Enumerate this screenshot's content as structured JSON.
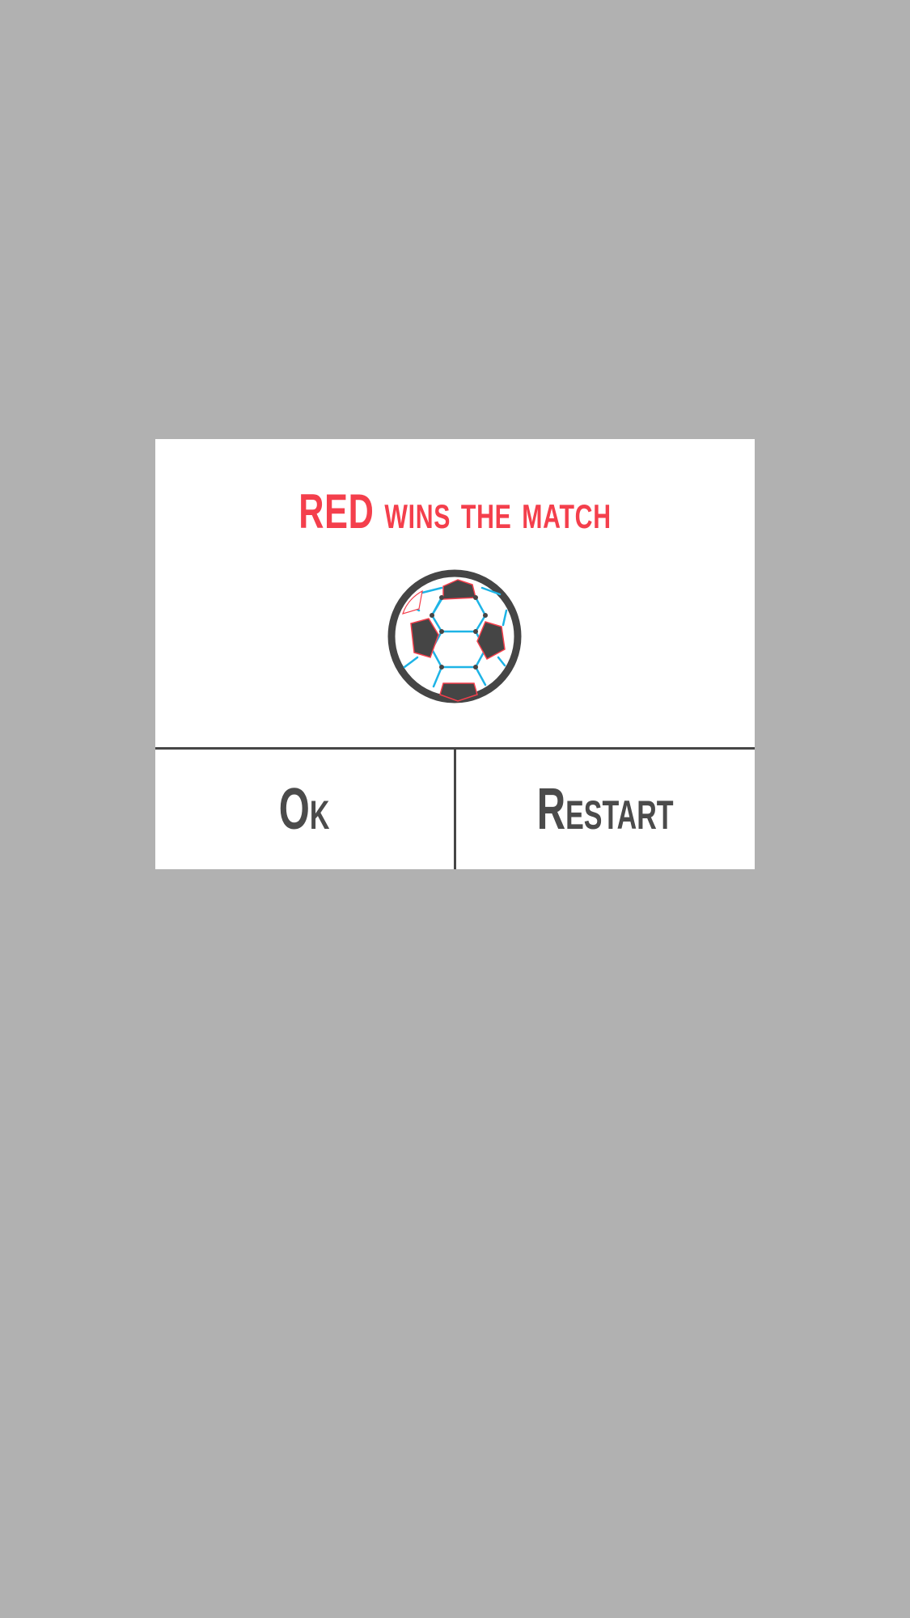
{
  "dialog": {
    "title": "RED wins the match",
    "icon": "soccer-ball-icon",
    "ok_label": "Ok",
    "restart_label": "Restart"
  },
  "colors": {
    "backdrop": "#b1b1b1",
    "panel": "#ffffff",
    "title": "#f43f4c",
    "button_text": "#4b4b4b",
    "divider": "#464646",
    "ball_dark": "#454545",
    "ball_seam_blue": "#1eb4e6",
    "ball_seam_red": "#f43f4c"
  }
}
